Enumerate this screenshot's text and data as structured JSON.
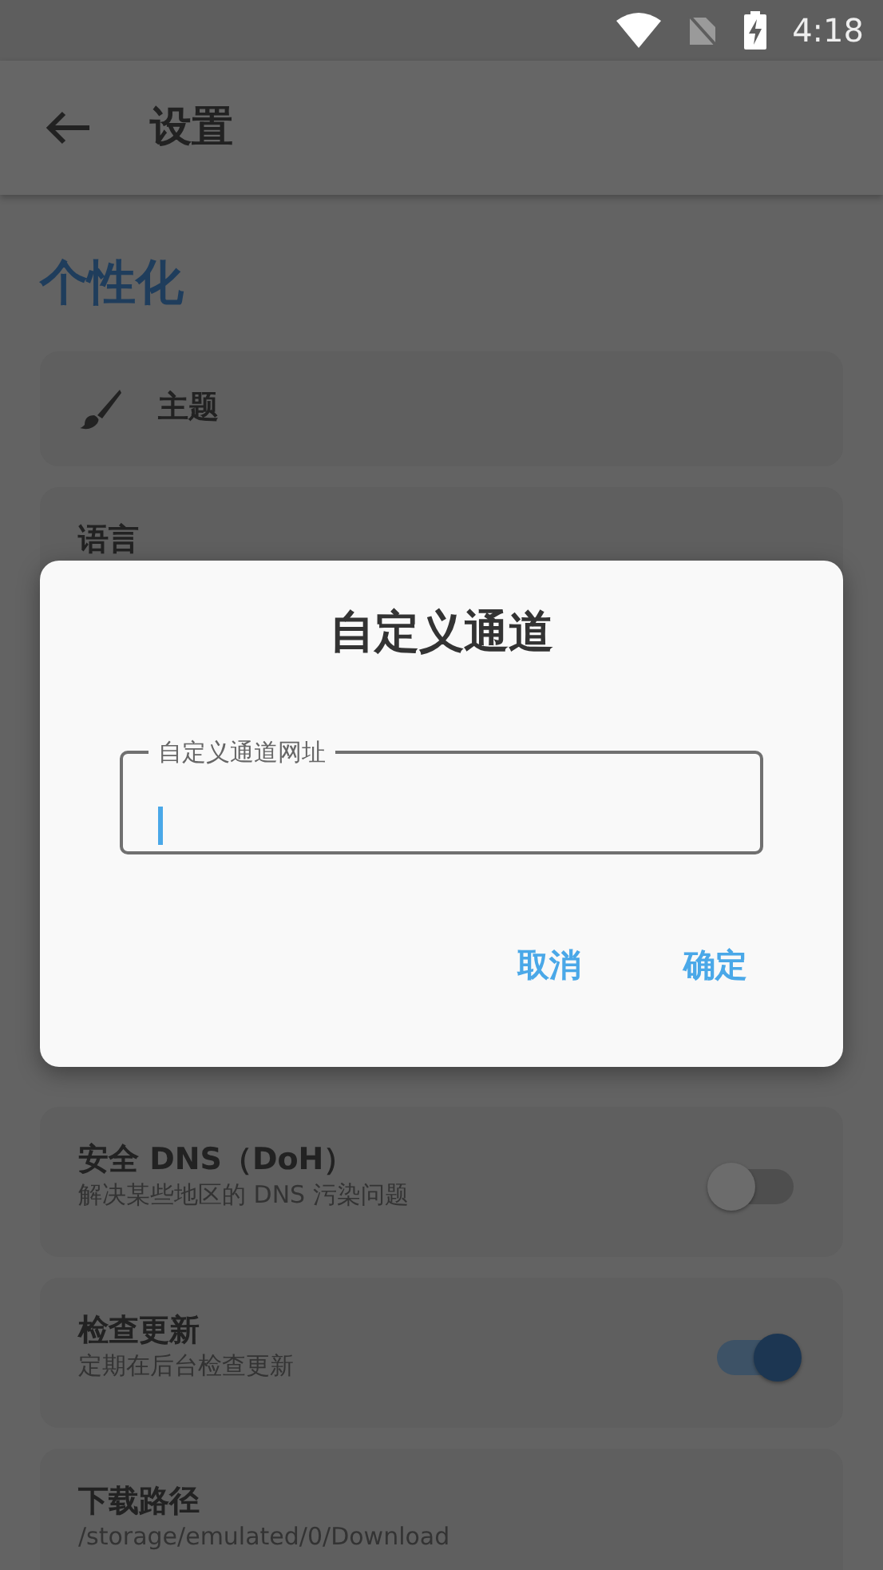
{
  "status_bar": {
    "time": "4:18"
  },
  "app_bar": {
    "title": "设置"
  },
  "section": {
    "title": "个性化"
  },
  "settings": [
    {
      "kind": "icon",
      "title": "主题"
    },
    {
      "kind": "plain",
      "title": "语言"
    },
    {
      "kind": "switch",
      "title": "安全 DNS（DoH）",
      "subtitle": "解决某些地区的 DNS 污染问题",
      "on": false
    },
    {
      "kind": "switch",
      "title": "检查更新",
      "subtitle": "定期在后台检查更新",
      "on": true
    },
    {
      "kind": "text",
      "title": "下载路径",
      "subtitle": "/storage/emulated/0/Download"
    }
  ],
  "dialog": {
    "title": "自定义通道",
    "field": {
      "label": "自定义通道网址",
      "focused": true
    },
    "buttons": [
      {
        "label": "取消"
      },
      {
        "label": "确定"
      }
    ]
  }
}
